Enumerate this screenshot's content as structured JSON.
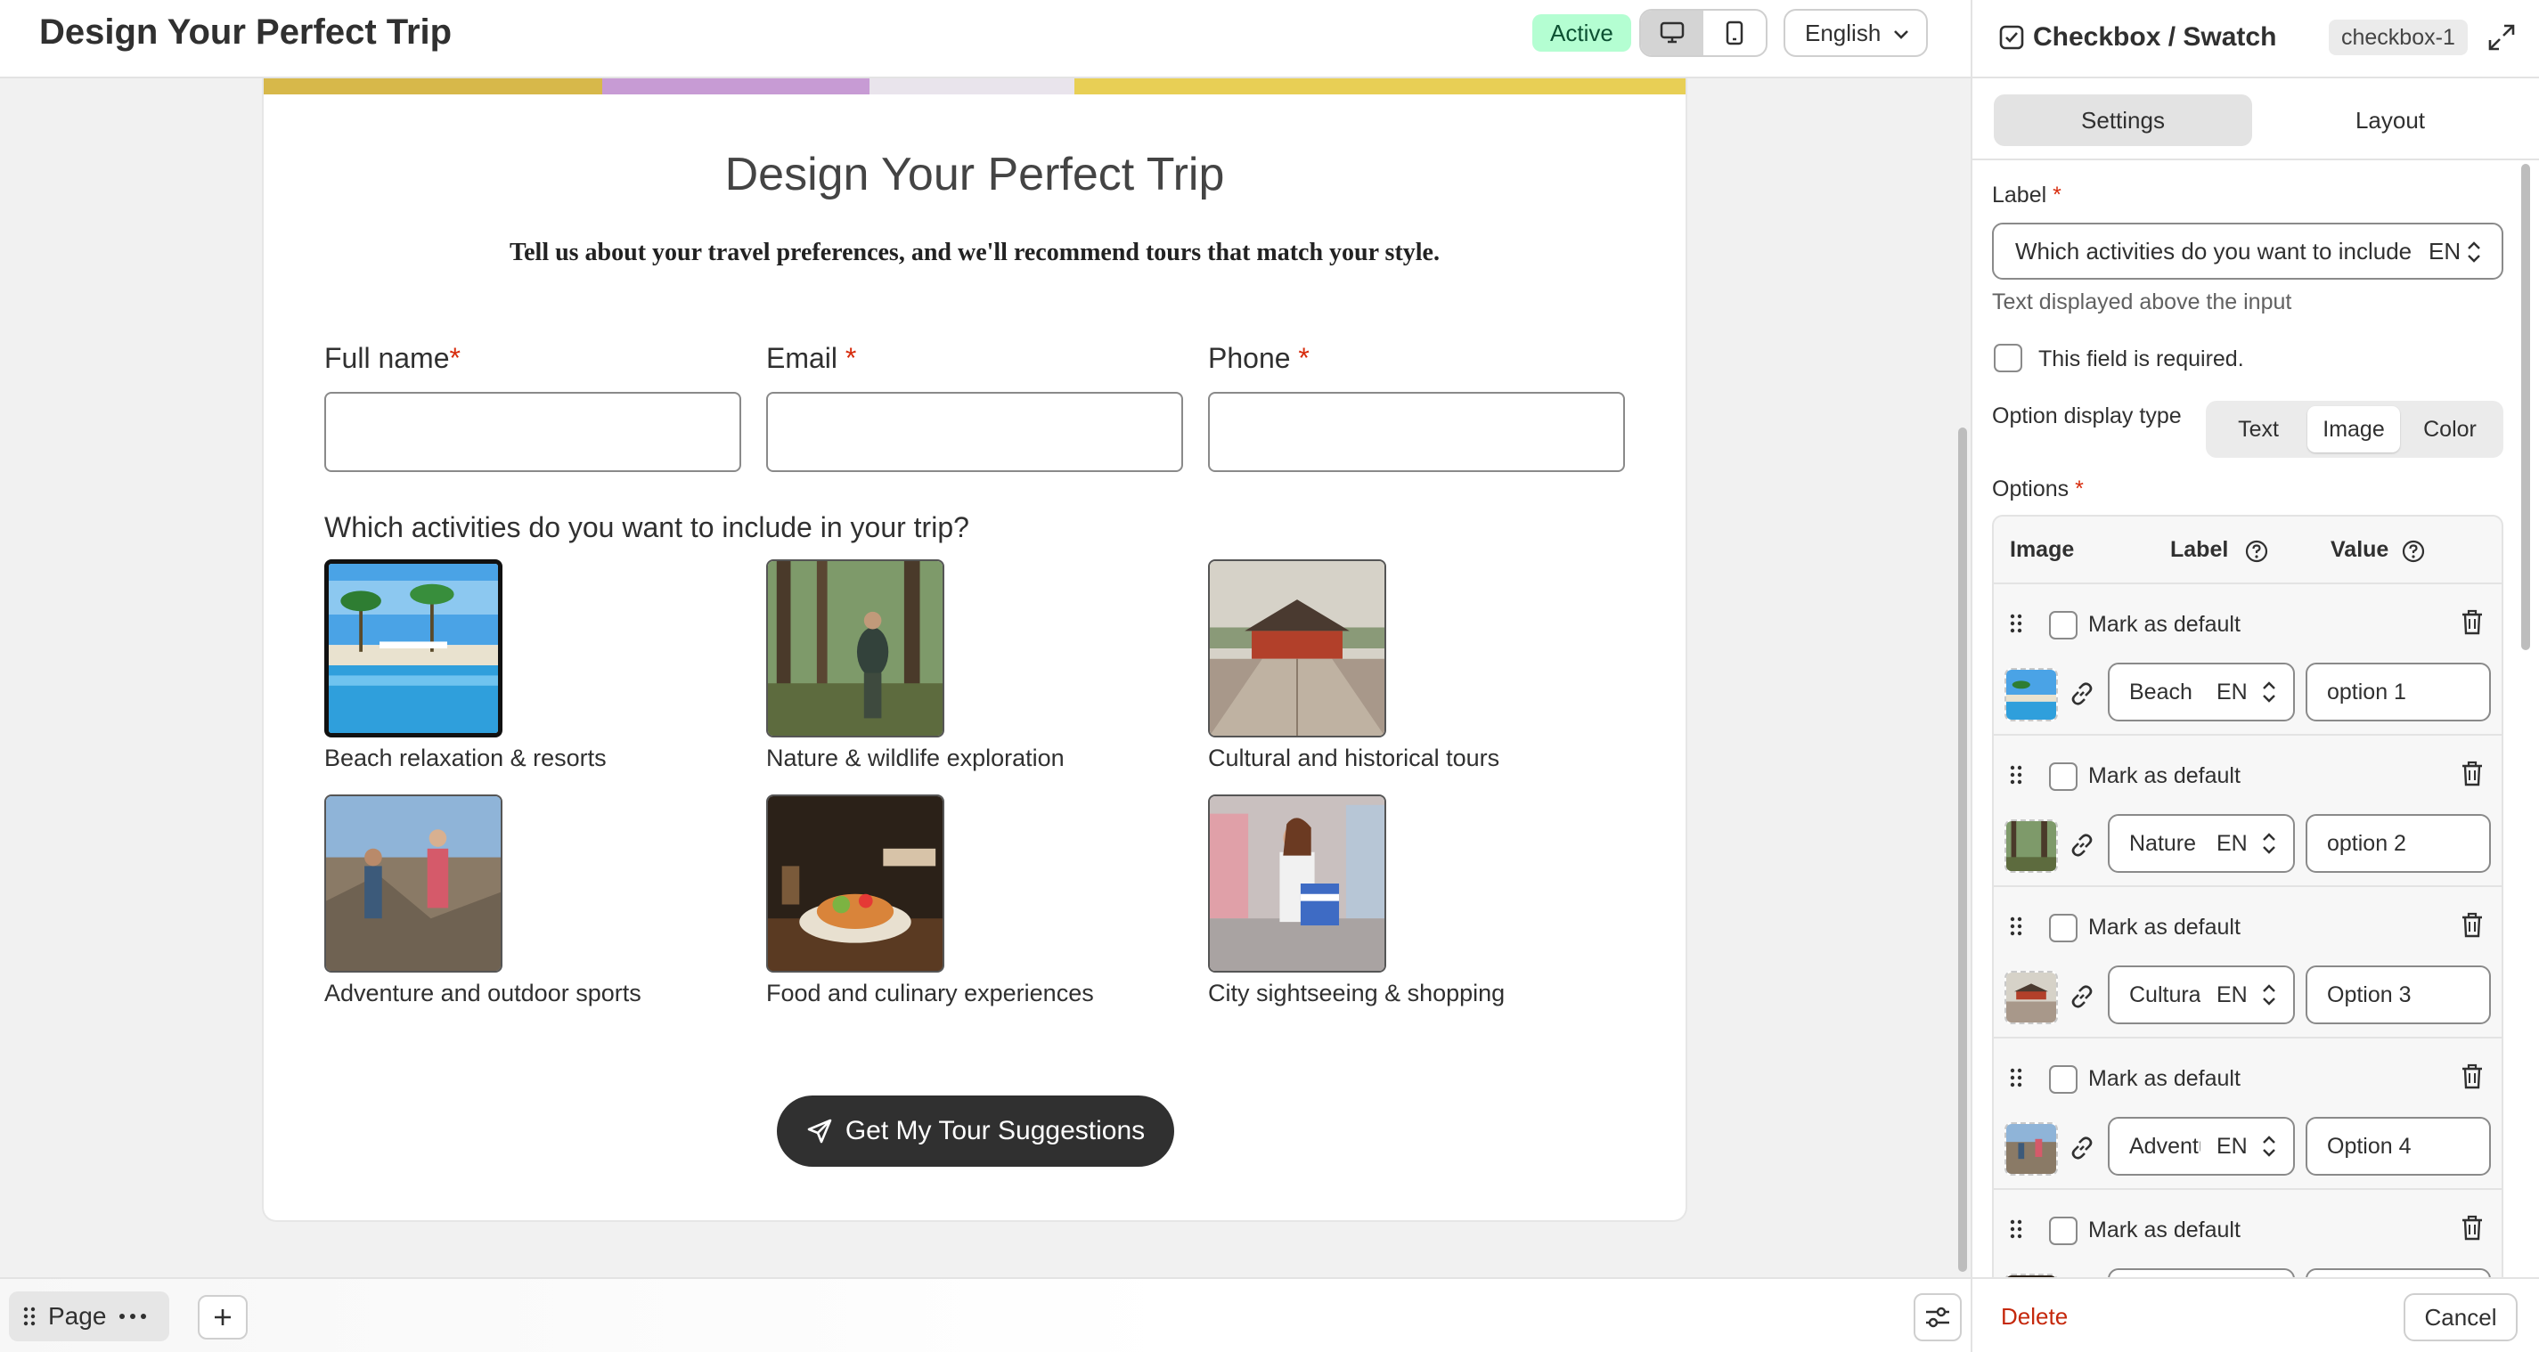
{
  "topbar": {
    "title": "Design Your Perfect Trip",
    "status": "Active",
    "status_color": "#b4fed2",
    "device_desktop_icon": "desktop-icon",
    "device_mobile_icon": "mobile-icon",
    "language": "English"
  },
  "form": {
    "title": "Design Your Perfect Trip",
    "subtitle": "Tell us about your travel preferences, and we'll recommend tours that match your style.",
    "fields": [
      {
        "label": "Full name",
        "required": "*"
      },
      {
        "label": "Email ",
        "required": "*"
      },
      {
        "label": "Phone ",
        "required": "*"
      }
    ],
    "question": "Which activities do you want to include in your trip?",
    "options": [
      {
        "label": "Beach relaxation & resorts",
        "selected": true
      },
      {
        "label": "Nature & wildlife exploration",
        "selected": false
      },
      {
        "label": "Cultural and historical tours",
        "selected": false
      },
      {
        "label": "Adventure and outdoor sports",
        "selected": false
      },
      {
        "label": "Food and culinary experiences",
        "selected": false
      },
      {
        "label": "City sightseeing & shopping",
        "selected": false
      }
    ],
    "submit_label": "Get My Tour Suggestions",
    "submit_icon": "send-icon"
  },
  "bottombar": {
    "page_label": "Page"
  },
  "panel": {
    "title": "Checkbox / Swatch",
    "component_id": "checkbox-1",
    "tabs": [
      "Settings",
      "Layout"
    ],
    "active_tab": "Settings",
    "label_title": "Label",
    "required_mark": "*",
    "label_value": "Which activities do you want to include in your trip?",
    "label_lang": "EN",
    "label_help": "Text displayed above the input",
    "required_text": "This field is required.",
    "display_type_label": "Option display type",
    "display_types": [
      "Text",
      "Image",
      "Color"
    ],
    "display_type_selected": "Image",
    "options_title": "Options",
    "table_headers": {
      "image": "Image",
      "label": "Label",
      "value": "Value"
    },
    "mark_default_text": "Mark as default",
    "rows": [
      {
        "label": "Beach",
        "lang": "EN",
        "value": "option 1"
      },
      {
        "label": "Nature",
        "lang": "EN",
        "value": "option 2"
      },
      {
        "label": "Cultural",
        "lang": "EN",
        "value": "Option 3"
      },
      {
        "label": "Adventure",
        "lang": "EN",
        "value": "Option 4"
      },
      {
        "label": "",
        "lang": "",
        "value": ""
      }
    ],
    "delete_label": "Delete",
    "cancel_label": "Cancel",
    "delete_color": "#c5280c"
  }
}
